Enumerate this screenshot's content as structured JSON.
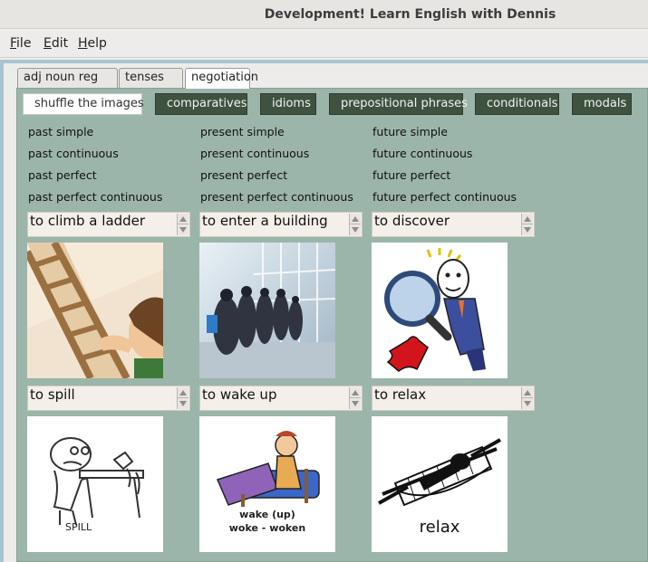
{
  "window": {
    "title": "Development! Learn English with Dennis"
  },
  "menu": [
    {
      "pre": "",
      "u": "F",
      "post": "ile"
    },
    {
      "pre": "",
      "u": "E",
      "post": "dit"
    },
    {
      "pre": "",
      "u": "H",
      "post": "elp"
    }
  ],
  "tabs": [
    {
      "label": "adj noun reg verb"
    },
    {
      "label": "tenses tab"
    },
    {
      "label": "negotiation"
    }
  ],
  "toolbar": [
    {
      "label": "shuffle the images"
    },
    {
      "label": "comparatives"
    },
    {
      "label": "idioms"
    },
    {
      "label": "prepositional phrases"
    },
    {
      "label": "conditionals"
    },
    {
      "label": "modals"
    }
  ],
  "tenses": {
    "past": [
      "past simple",
      "past continuous",
      "past perfect",
      "past perfect continuous"
    ],
    "present": [
      "present simple",
      "present continuous",
      "present perfect",
      "present perfect continuous"
    ],
    "future": [
      "future simple",
      "future continuous",
      "future perfect",
      "future perfect continuous"
    ]
  },
  "verbs": [
    {
      "value": "to climb a ladder",
      "icon": "climb-ladder-image"
    },
    {
      "value": "to enter a building",
      "icon": "enter-building-image"
    },
    {
      "value": "to discover",
      "icon": "discover-image"
    },
    {
      "value": "to spill",
      "icon": "spill-image"
    },
    {
      "value": "to wake up",
      "icon": "wake-up-image"
    },
    {
      "value": "to relax",
      "icon": "relax-image"
    }
  ],
  "image_text": {
    "spill": "SPILL",
    "wake_line1": "wake (up)",
    "wake_line2": "woke - woken",
    "relax": "relax"
  }
}
